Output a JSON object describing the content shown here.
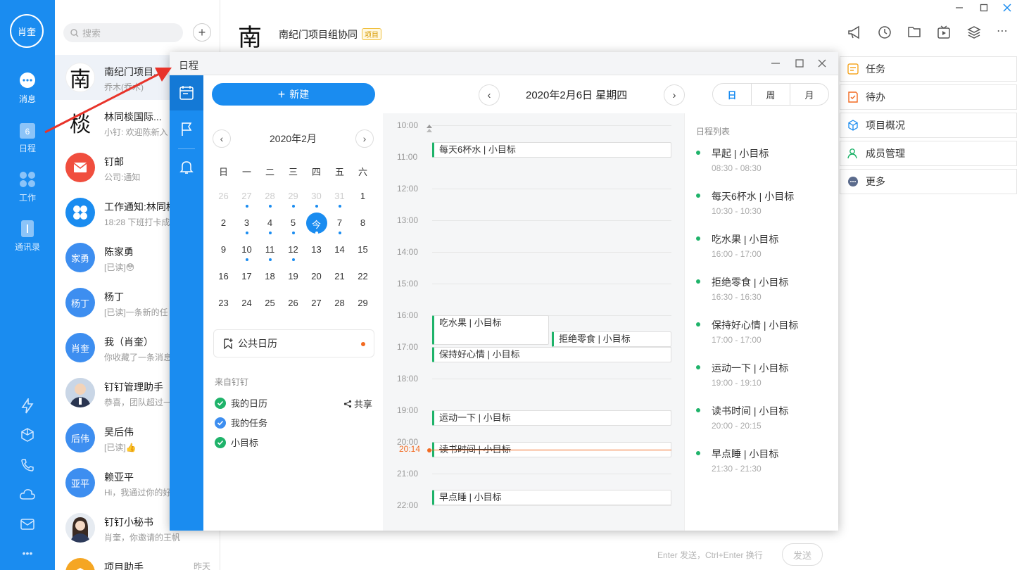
{
  "rail": {
    "user_initials": "肖奎",
    "items": [
      {
        "label": "消息"
      },
      {
        "label": "日程",
        "badge": "6"
      },
      {
        "label": "工作"
      },
      {
        "label": "通讯录"
      }
    ],
    "more": "•••"
  },
  "chatlist": {
    "search_placeholder": "搜索",
    "add_symbol": "+",
    "chats": [
      {
        "name": "南纪门项目...",
        "sub": "乔木(乔木)",
        "avatar_text": "南"
      },
      {
        "name": "林同棪国际...",
        "sub": "小钉: 欢迎陈新入",
        "avatar_text": "棪"
      },
      {
        "name": "钉邮",
        "sub": "公司:通知",
        "avatar_text": ""
      },
      {
        "name": "工作通知:林同棪",
        "sub": "18:28 下班打卡成",
        "avatar_text": ""
      },
      {
        "name": "陈家勇",
        "sub": "[已读]😳",
        "avatar_text": "家勇"
      },
      {
        "name": "杨丁",
        "sub": "[已读]一条新的任",
        "avatar_text": "杨丁"
      },
      {
        "name": "我（肖奎）",
        "sub": "你收藏了一条消息",
        "avatar_text": "肖奎"
      },
      {
        "name": "钉钉管理助手",
        "sub": "恭喜，团队超过一",
        "avatar_text": ""
      },
      {
        "name": "吴后伟",
        "sub": "[已读]👍",
        "avatar_text": "后伟"
      },
      {
        "name": "赖亚平",
        "sub": "Hi，我通过你的好",
        "avatar_text": "亚平"
      },
      {
        "name": "钉钉小秘书",
        "sub": "肖奎，你邀请的王帆",
        "avatar_text": ""
      },
      {
        "name": "项目助手",
        "sub": "",
        "avatar_text": "",
        "time": "昨天"
      }
    ]
  },
  "header": {
    "logo_char": "南",
    "title": "南纪门项目组协同",
    "badge": "项目"
  },
  "right_panel": {
    "items": [
      {
        "label": "任务",
        "color": "#f5a623"
      },
      {
        "label": "待办",
        "color": "#f26a21"
      },
      {
        "label": "项目概况",
        "color": "#1a8cf0"
      },
      {
        "label": "成员管理",
        "color": "#1fb36a"
      },
      {
        "label": "更多",
        "color": "#5b6b8c"
      }
    ]
  },
  "composer": {
    "hint": "Enter 发送，Ctrl+Enter 换行",
    "send": "发送"
  },
  "calendar": {
    "window_title": "日程",
    "new_button": "新建",
    "mini_month": "2020年2月",
    "weekdays": [
      "日",
      "一",
      "二",
      "三",
      "四",
      "五",
      "六"
    ],
    "weeks": [
      [
        {
          "d": "26",
          "g": true
        },
        {
          "d": "27",
          "g": true,
          "dot": true
        },
        {
          "d": "28",
          "g": true,
          "dot": true
        },
        {
          "d": "29",
          "g": true,
          "dot": true
        },
        {
          "d": "30",
          "g": true,
          "dot": true
        },
        {
          "d": "31",
          "g": true,
          "dot": true
        },
        {
          "d": "1"
        }
      ],
      [
        {
          "d": "2"
        },
        {
          "d": "3",
          "dot": true
        },
        {
          "d": "4",
          "dot": true
        },
        {
          "d": "5",
          "dot": true
        },
        {
          "d": "今",
          "today": true,
          "dot": true
        },
        {
          "d": "7",
          "dot": true
        },
        {
          "d": "8"
        }
      ],
      [
        {
          "d": "9"
        },
        {
          "d": "10",
          "dot": true
        },
        {
          "d": "11",
          "dot": true
        },
        {
          "d": "12",
          "dot": true
        },
        {
          "d": "13"
        },
        {
          "d": "14"
        },
        {
          "d": "15"
        }
      ],
      [
        {
          "d": "16"
        },
        {
          "d": "17"
        },
        {
          "d": "18"
        },
        {
          "d": "19"
        },
        {
          "d": "20"
        },
        {
          "d": "21"
        },
        {
          "d": "22"
        }
      ],
      [
        {
          "d": "23"
        },
        {
          "d": "24"
        },
        {
          "d": "25"
        },
        {
          "d": "26"
        },
        {
          "d": "27"
        },
        {
          "d": "28"
        },
        {
          "d": "29"
        }
      ]
    ],
    "public_calendar": "公共日历",
    "from_label": "来自钉钉",
    "calendars": [
      {
        "label": "我的日历",
        "color": "#1fb36a"
      },
      {
        "label": "我的任务",
        "color": "#3d8ef0"
      },
      {
        "label": "小目标",
        "color": "#1fb36a"
      }
    ],
    "share": "共享",
    "day_title": "2020年2月6日 星期四",
    "views": [
      "日",
      "周",
      "月"
    ],
    "active_view": "日",
    "hours": [
      "10:00",
      "11:00",
      "12:00",
      "13:00",
      "14:00",
      "15:00",
      "16:00",
      "17:00",
      "18:00",
      "19:00",
      "20:00",
      "21:00",
      "22:00"
    ],
    "now_time": "20:14",
    "timeline_events": [
      "每天6杯水 | 小目标",
      "吃水果 | 小目标",
      "拒绝零食 | 小目标",
      "保持好心情 | 小目标",
      "运动一下 | 小目标",
      "读书时间 | 小目标",
      "早点睡 | 小目标"
    ],
    "schedule_title": "日程列表",
    "schedule": [
      {
        "title": "早起 | 小目标",
        "time": "08:30 - 08:30"
      },
      {
        "title": "每天6杯水 | 小目标",
        "time": "10:30 - 10:30"
      },
      {
        "title": "吃水果 | 小目标",
        "time": "16:00 - 17:00"
      },
      {
        "title": "拒绝零食 | 小目标",
        "time": "16:30 - 16:30"
      },
      {
        "title": "保持好心情 | 小目标",
        "time": "17:00 - 17:00"
      },
      {
        "title": "运动一下 | 小目标",
        "time": "19:00 - 19:10"
      },
      {
        "title": "读书时间 | 小目标",
        "time": "20:00 - 20:15"
      },
      {
        "title": "早点睡 | 小目标",
        "time": "21:30 - 21:30"
      }
    ]
  }
}
